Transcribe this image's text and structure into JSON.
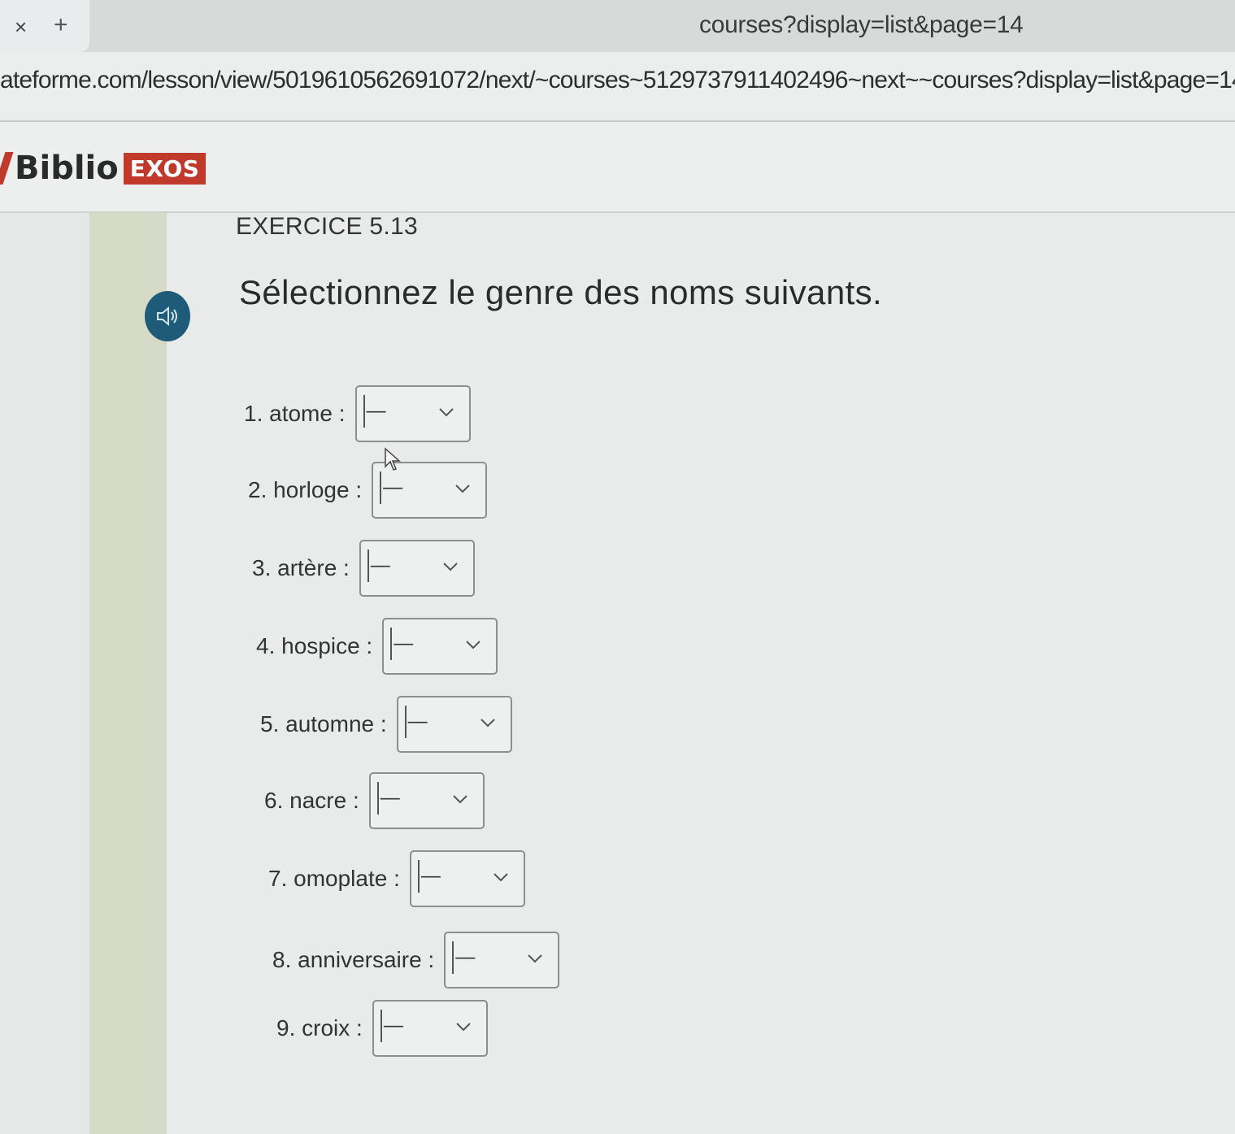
{
  "browser": {
    "tab_close_glyph": "×",
    "new_tab_glyph": "+",
    "tab_url_tail": "courses?display=list&page=14",
    "address": "ateforme.com/lesson/view/5019610562691072/next/~courses~5129737911402496~next~~courses?display=list&page=14"
  },
  "site": {
    "logo_word": "Biblio",
    "logo_badge": "EXOS",
    "brand_color": "#c0392b"
  },
  "exercise": {
    "number": "EXERCICE 5.13",
    "instruction": "Sélectionnez le genre des noms suivants.",
    "audio_icon": "speaker-icon",
    "items": [
      {
        "label": "1. atome :",
        "value": "—"
      },
      {
        "label": "2. horloge :",
        "value": "—"
      },
      {
        "label": "3. artère :",
        "value": "—"
      },
      {
        "label": "4. hospice :",
        "value": "—"
      },
      {
        "label": "5. automne :",
        "value": "—"
      },
      {
        "label": "6. nacre :",
        "value": "—"
      },
      {
        "label": "7. omoplate :",
        "value": "—"
      },
      {
        "label": "8.  anniversaire :",
        "value": "—"
      },
      {
        "label": "9. croix :",
        "value": "—"
      }
    ]
  }
}
